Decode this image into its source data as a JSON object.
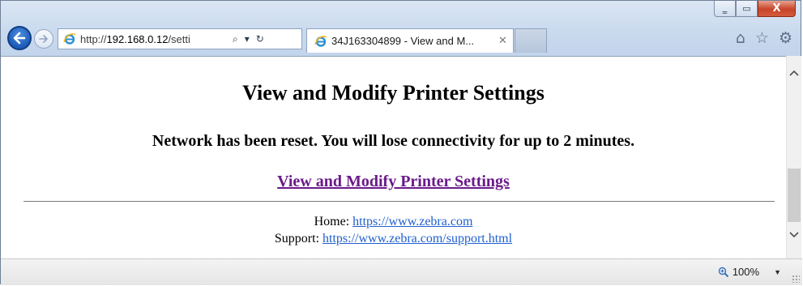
{
  "browser": {
    "address": {
      "scheme": "http://",
      "host": "192.168.0.12",
      "path": "/setti",
      "favicon": "ie-icon",
      "search_glyph": "⌕",
      "dropdown_glyph": "▾",
      "refresh_glyph": "↻"
    },
    "tab": {
      "title": "34J163304899 - View and M...",
      "close_glyph": "✕",
      "favicon": "ie-icon"
    },
    "toolbar": {
      "home_glyph": "⌂",
      "favorites_glyph": "☆",
      "tools_glyph": "⚙"
    },
    "window": {
      "minimize_glyph": "‗",
      "maximize_glyph": "▭",
      "close_glyph": "X"
    }
  },
  "page": {
    "title": "View and Modify Printer Settings",
    "message": "Network has been reset. You will lose connectivity for up to 2 minutes.",
    "settings_link": "View and Modify Printer Settings",
    "home_label": "Home: ",
    "home_link": "https://www.zebra.com",
    "support_label": "Support: ",
    "support_link": "https://www.zebra.com/support.html"
  },
  "statusbar": {
    "zoom": "100%",
    "zoom_caret": "▼"
  },
  "colors": {
    "visited_link": "#6a1a8a",
    "link": "#1f5fce",
    "close_button": "#c7452a",
    "back_button": "#1c5bb8"
  }
}
